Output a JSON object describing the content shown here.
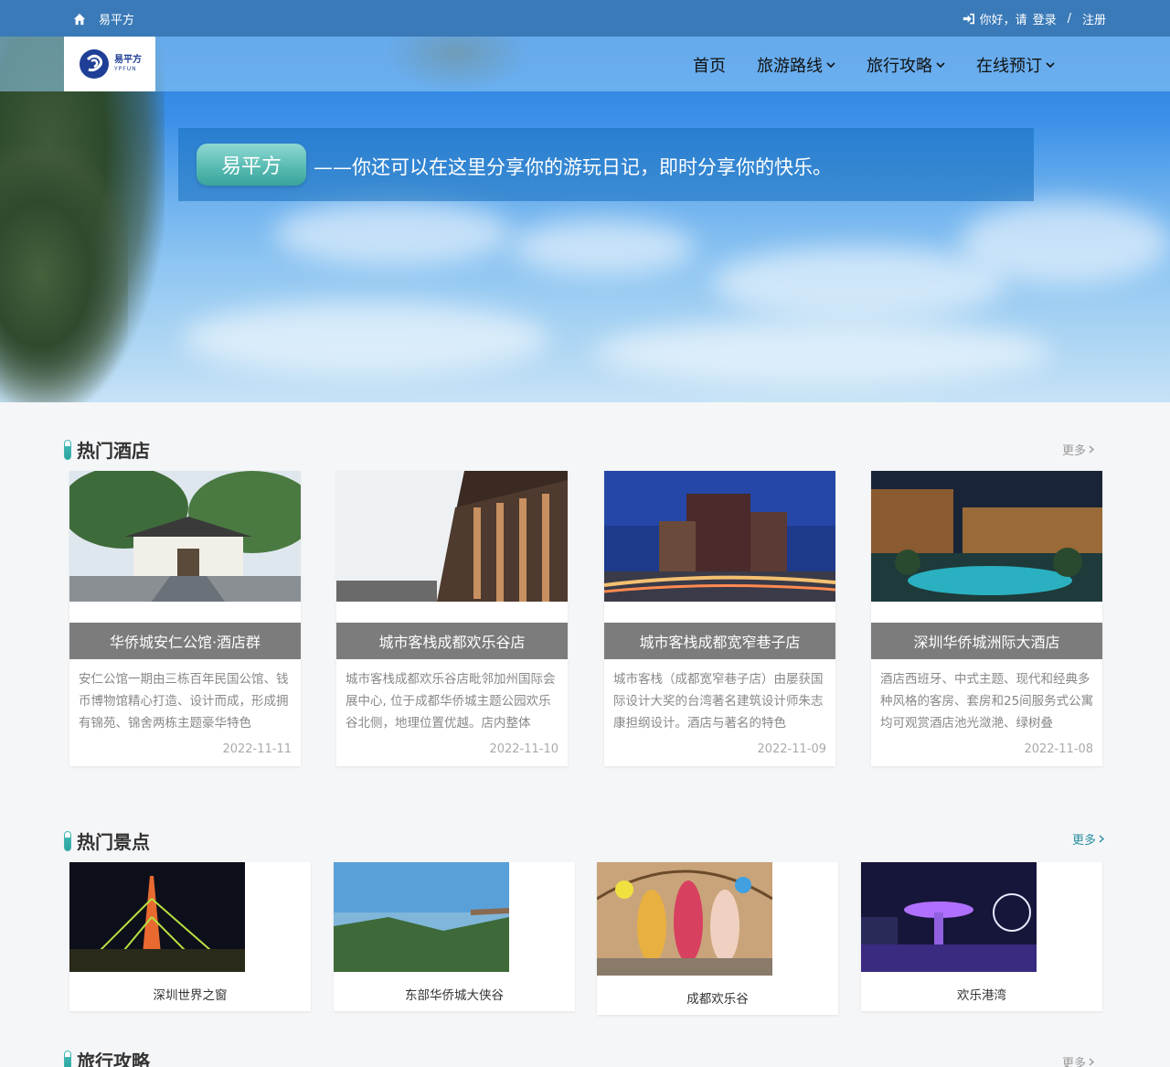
{
  "topbar": {
    "site_name": "易平方",
    "greeting": "你好，请",
    "login": "登录",
    "separator": "/",
    "register": "注册"
  },
  "logo": {
    "cn": "易平方",
    "en": "YPFUN"
  },
  "nav": {
    "items": [
      {
        "label": "首页",
        "has_dropdown": false
      },
      {
        "label": "旅游路线",
        "has_dropdown": true
      },
      {
        "label": "旅行攻略",
        "has_dropdown": true
      },
      {
        "label": "在线预订",
        "has_dropdown": true
      }
    ]
  },
  "hero": {
    "badge": "易平方",
    "slogan": "——你还可以在这里分享你的游玩日记，即时分享你的快乐。"
  },
  "hotels_section": {
    "title": "热门酒店",
    "more": "更多",
    "cards": [
      {
        "name": "华侨城安仁公馆·酒店群",
        "desc": "安仁公馆一期由三栋百年民国公馆、钱币博物馆精心打造、设计而成，形成拥有锦苑、锦舍两栋主题豪华特色",
        "date": "2022-11-11"
      },
      {
        "name": "城市客栈成都欢乐谷店",
        "desc": "城市客栈成都欢乐谷店毗邻加州国际会展中心, 位于成都华侨城主题公园欢乐谷北侧，地理位置优越。店内整体",
        "date": "2022-11-10"
      },
      {
        "name": "城市客栈成都宽窄巷子店",
        "desc": "城市客栈（成都宽窄巷子店）由屡获国际设计大奖的台湾著名建筑设计师朱志康担纲设计。酒店与著名的特色",
        "date": "2022-11-09"
      },
      {
        "name": "深圳华侨城洲际大酒店",
        "desc": "酒店西班牙、中式主题、现代和经典多种风格的客房、套房和25间服务式公寓均可观赏酒店池光潋滟、绿树叠",
        "date": "2022-11-08"
      }
    ]
  },
  "spots_section": {
    "title": "热门景点",
    "more": "更多",
    "cards": [
      {
        "name": "深圳世界之窗"
      },
      {
        "name": "东部华侨城大侠谷"
      },
      {
        "name": "成都欢乐谷"
      },
      {
        "name": "欢乐港湾"
      }
    ]
  },
  "guides_section": {
    "title": "旅行攻略",
    "more": "更多"
  },
  "colors": {
    "topbar": "#3a7ab8",
    "accent": "#3fb5b0",
    "card_title_bg": "#7c7c7c"
  }
}
